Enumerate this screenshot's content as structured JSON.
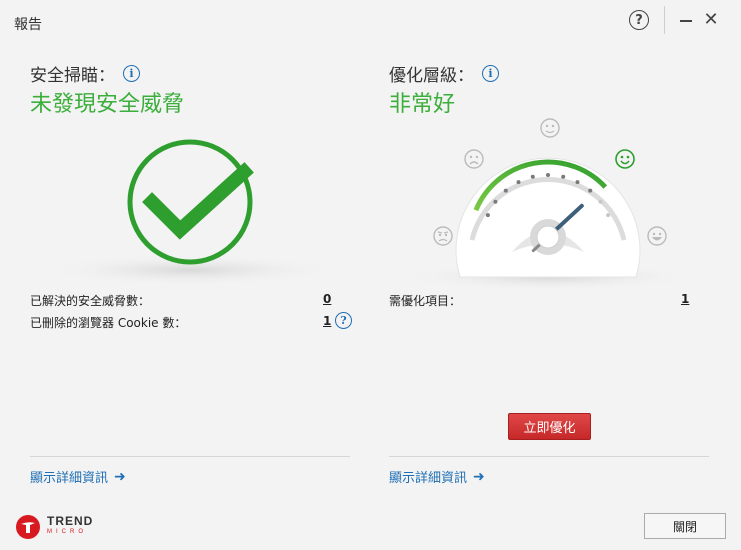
{
  "window": {
    "title": "報告",
    "help_glyph": "?",
    "close_glyph": "✕"
  },
  "scan": {
    "label": "安全掃瞄：",
    "status": "未發現安全威脅",
    "rows": [
      {
        "label": "已解決的安全威脅數：",
        "value": "0"
      },
      {
        "label": "已刪除的瀏覽器 Cookie 數：",
        "value": "1"
      }
    ],
    "details_link": "顯示詳細資訊",
    "colors": {
      "status_green": "#3bae3b",
      "check_green": "#2e9e2e"
    }
  },
  "optimization": {
    "label": "優化層級：",
    "status": "非常好",
    "gauge_level": 0.85,
    "rows": [
      {
        "label": "需優化項目：",
        "value": "1"
      }
    ],
    "optimize_button": "立即優化",
    "details_link": "顯示詳細資訊"
  },
  "footer": {
    "logo_line1": "TREND",
    "logo_line2": "MICRO",
    "close_button": "關閉"
  },
  "icons": {
    "info": "i",
    "arrow": "➜",
    "question": "?"
  }
}
